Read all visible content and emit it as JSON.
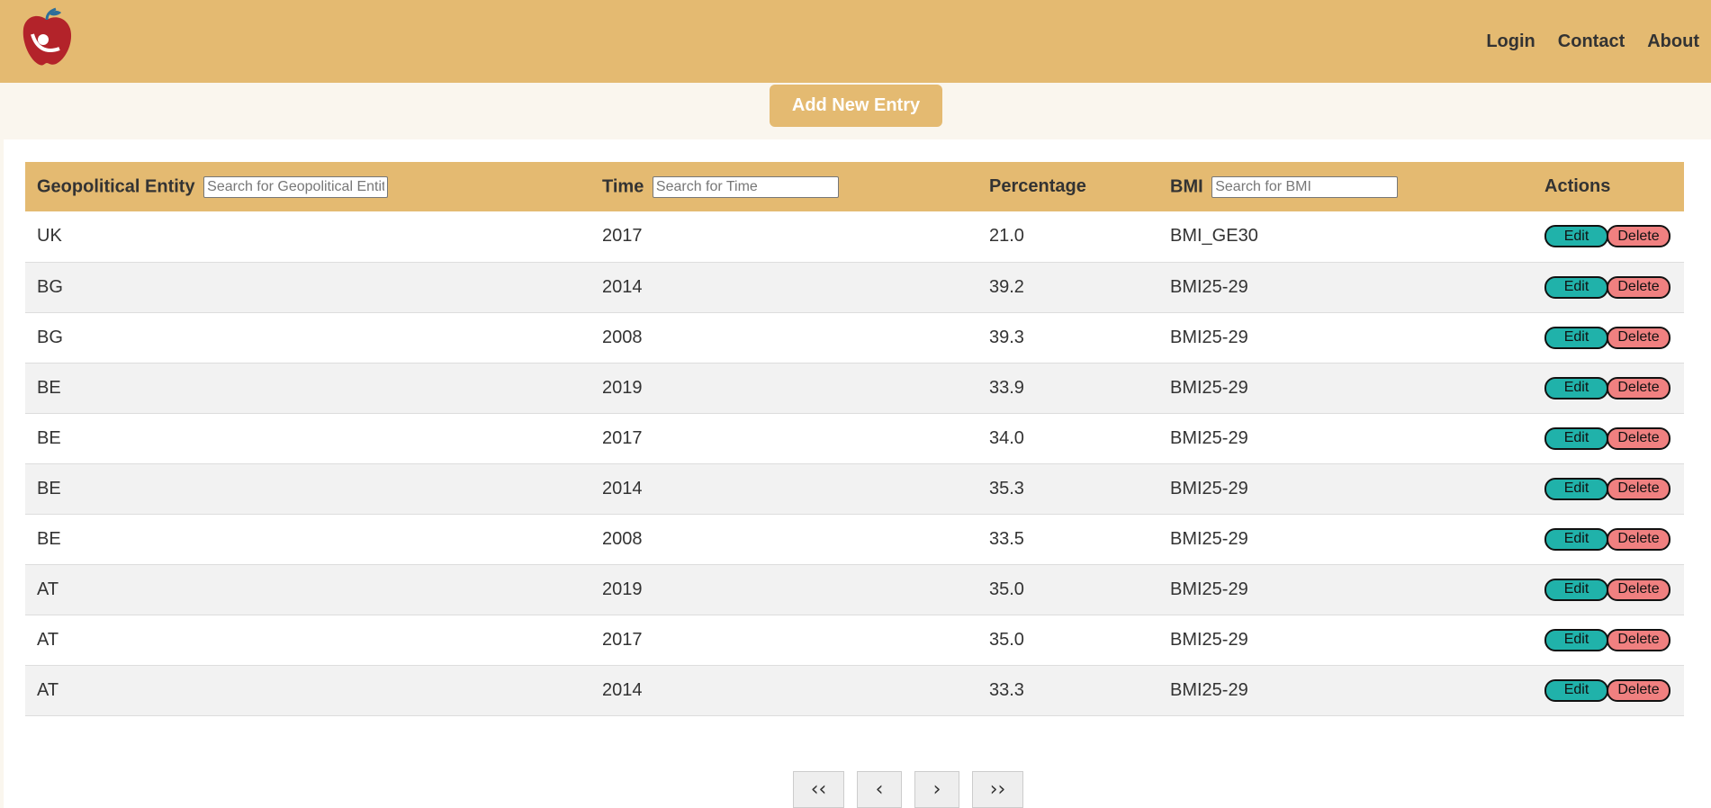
{
  "nav": {
    "links": [
      "Login",
      "Contact",
      "About"
    ]
  },
  "toolbar": {
    "add_label": "Add New Entry"
  },
  "table": {
    "headers": {
      "geo": "Geopolitical Entity",
      "time": "Time",
      "percentage": "Percentage",
      "bmi": "BMI",
      "actions": "Actions"
    },
    "search_placeholders": {
      "geo": "Search for Geopolitical Entity",
      "time": "Search for Time",
      "bmi": "Search for BMI"
    },
    "rows": [
      {
        "geo": "UK",
        "time": "2017",
        "percentage": "21.0",
        "bmi": "BMI_GE30"
      },
      {
        "geo": "BG",
        "time": "2014",
        "percentage": "39.2",
        "bmi": "BMI25-29"
      },
      {
        "geo": "BG",
        "time": "2008",
        "percentage": "39.3",
        "bmi": "BMI25-29"
      },
      {
        "geo": "BE",
        "time": "2019",
        "percentage": "33.9",
        "bmi": "BMI25-29"
      },
      {
        "geo": "BE",
        "time": "2017",
        "percentage": "34.0",
        "bmi": "BMI25-29"
      },
      {
        "geo": "BE",
        "time": "2014",
        "percentage": "35.3",
        "bmi": "BMI25-29"
      },
      {
        "geo": "BE",
        "time": "2008",
        "percentage": "33.5",
        "bmi": "BMI25-29"
      },
      {
        "geo": "AT",
        "time": "2019",
        "percentage": "35.0",
        "bmi": "BMI25-29"
      },
      {
        "geo": "AT",
        "time": "2017",
        "percentage": "35.0",
        "bmi": "BMI25-29"
      },
      {
        "geo": "AT",
        "time": "2014",
        "percentage": "33.3",
        "bmi": "BMI25-29"
      }
    ],
    "edit_label": "Edit",
    "delete_label": "Delete"
  },
  "pagination": {
    "first": "‹‹",
    "prev": "‹",
    "next": "›",
    "last": "››"
  },
  "colors": {
    "brand": "#e4ba71",
    "edit": "#20b2aa",
    "delete": "#f08080"
  },
  "icons": {
    "logo": "apple-person-logo-icon"
  }
}
